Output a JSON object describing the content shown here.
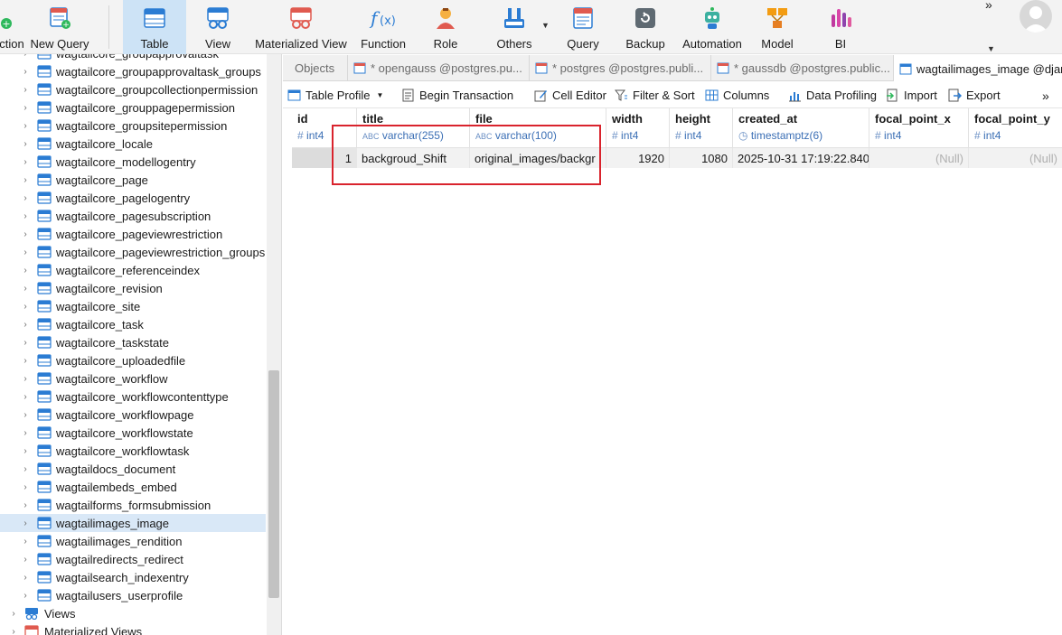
{
  "toolbar": {
    "buttons": [
      {
        "label": "ction",
        "icon": "connection-icon"
      },
      {
        "label": "New Query",
        "icon": "new-query-icon"
      },
      {
        "label": "Table",
        "icon": "table-icon"
      },
      {
        "label": "View",
        "icon": "view-icon"
      },
      {
        "label": "Materialized View",
        "icon": "materialized-view-icon"
      },
      {
        "label": "Function",
        "icon": "function-icon"
      },
      {
        "label": "Role",
        "icon": "role-icon"
      },
      {
        "label": "Others",
        "icon": "others-icon"
      },
      {
        "label": "Query",
        "icon": "query-icon"
      },
      {
        "label": "Backup",
        "icon": "backup-icon"
      },
      {
        "label": "Automation",
        "icon": "automation-icon"
      },
      {
        "label": "Model",
        "icon": "model-icon"
      },
      {
        "label": "BI",
        "icon": "bi-icon"
      }
    ],
    "overflow": "»"
  },
  "navigator": {
    "items": [
      "wagtailcore_groupapprovaltask",
      "wagtailcore_groupapprovaltask_groups",
      "wagtailcore_groupcollectionpermission",
      "wagtailcore_grouppagepermission",
      "wagtailcore_groupsitepermission",
      "wagtailcore_locale",
      "wagtailcore_modellogentry",
      "wagtailcore_page",
      "wagtailcore_pagelogentry",
      "wagtailcore_pagesubscription",
      "wagtailcore_pageviewrestriction",
      "wagtailcore_pageviewrestriction_groups",
      "wagtailcore_referenceindex",
      "wagtailcore_revision",
      "wagtailcore_site",
      "wagtailcore_task",
      "wagtailcore_taskstate",
      "wagtailcore_uploadedfile",
      "wagtailcore_workflow",
      "wagtailcore_workflowcontenttype",
      "wagtailcore_workflowpage",
      "wagtailcore_workflowstate",
      "wagtailcore_workflowtask",
      "wagtaildocs_document",
      "wagtailembeds_embed",
      "wagtailforms_formsubmission",
      "wagtailimages_image",
      "wagtailimages_rendition",
      "wagtailredirects_redirect",
      "wagtailsearch_indexentry",
      "wagtailusers_userprofile"
    ],
    "selected": "wagtailimages_image",
    "groups": [
      "Views",
      "Materialized Views"
    ]
  },
  "tabs": [
    {
      "label": "Objects",
      "active": false
    },
    {
      "label": "* opengauss @postgres.pu...",
      "active": false
    },
    {
      "label": "* postgres @postgres.publi...",
      "active": false
    },
    {
      "label": "* gaussdb @postgres.public...",
      "active": false
    },
    {
      "label": "wagtailimages_image @djan",
      "active": true
    }
  ],
  "objbar": {
    "table_profile": "Table Profile",
    "begin_transaction": "Begin Transaction",
    "cell_editor": "Cell Editor",
    "filter_sort": "Filter & Sort",
    "columns": "Columns",
    "data_profiling": "Data Profiling",
    "import": "Import",
    "export": "Export",
    "overflow": "»"
  },
  "grid": {
    "columns": [
      {
        "name": "id",
        "type": "int4",
        "kind": "num"
      },
      {
        "name": "title",
        "type": "varchar(255)",
        "kind": "text"
      },
      {
        "name": "file",
        "type": "varchar(100)",
        "kind": "text"
      },
      {
        "name": "width",
        "type": "int4",
        "kind": "num"
      },
      {
        "name": "height",
        "type": "int4",
        "kind": "num"
      },
      {
        "name": "created_at",
        "type": "timestamptz(6)",
        "kind": "time"
      },
      {
        "name": "focal_point_x",
        "type": "int4",
        "kind": "num"
      },
      {
        "name": "focal_point_y",
        "type": "int4",
        "kind": "num"
      }
    ],
    "rows": [
      [
        "1",
        "backgroud_Shift",
        "original_images/backgr",
        "1920",
        "1080",
        "2025-10-31 17:19:22.840",
        "(Null)",
        "(Null)"
      ]
    ]
  },
  "colors": {
    "accent": "#2b7cd3",
    "selection": "#d9e8f7",
    "highlight_box": "#d9232d"
  }
}
